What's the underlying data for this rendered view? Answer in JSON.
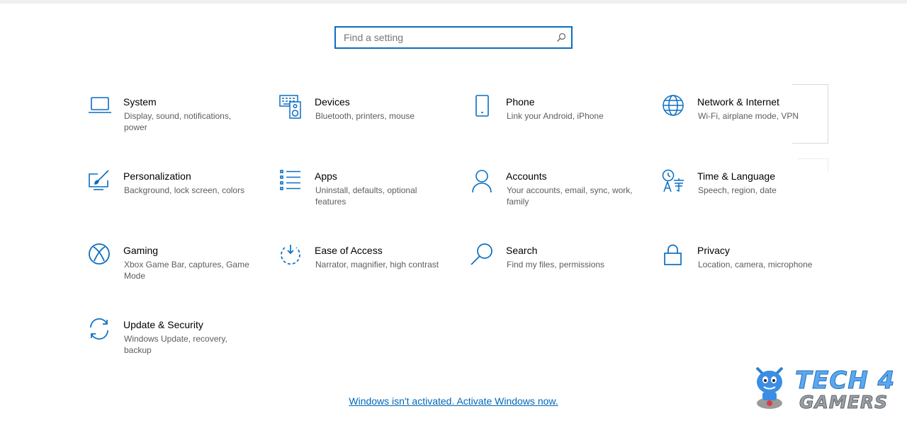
{
  "search": {
    "placeholder": "Find a setting",
    "value": ""
  },
  "tiles": [
    {
      "title": "System",
      "description": "Display, sound, notifications, power",
      "icon": "laptop-icon"
    },
    {
      "title": "Devices",
      "description": "Bluetooth, printers, mouse",
      "icon": "keyboard-speaker-icon"
    },
    {
      "title": "Phone",
      "description": "Link your Android, iPhone",
      "icon": "phone-icon"
    },
    {
      "title": "Network & Internet",
      "description": "Wi-Fi, airplane mode, VPN",
      "icon": "globe-icon"
    },
    {
      "title": "Personalization",
      "description": "Background, lock screen, colors",
      "icon": "paint-brush-icon"
    },
    {
      "title": "Apps",
      "description": "Uninstall, defaults, optional features",
      "icon": "apps-list-icon"
    },
    {
      "title": "Accounts",
      "description": "Your accounts, email, sync, work, family",
      "icon": "person-icon"
    },
    {
      "title": "Time & Language",
      "description": "Speech, region, date",
      "icon": "time-language-icon"
    },
    {
      "title": "Gaming",
      "description": "Xbox Game Bar, captures, Game Mode",
      "icon": "xbox-icon"
    },
    {
      "title": "Ease of Access",
      "description": "Narrator, magnifier, high contrast",
      "icon": "ease-of-access-icon"
    },
    {
      "title": "Search",
      "description": "Find my files, permissions",
      "icon": "magnifier-icon"
    },
    {
      "title": "Privacy",
      "description": "Location, camera, microphone",
      "icon": "lock-icon"
    },
    {
      "title": "Update & Security",
      "description": "Windows Update, recovery, backup",
      "icon": "sync-arrows-icon"
    }
  ],
  "activation_link": "Windows isn't activated. Activate Windows now.",
  "watermark": {
    "line1": "TECH 4",
    "line2": "GAMERS"
  },
  "colors": {
    "accent": "#0067b8",
    "icon": "#0a6ec2",
    "desc_text": "#5d5d5d"
  }
}
